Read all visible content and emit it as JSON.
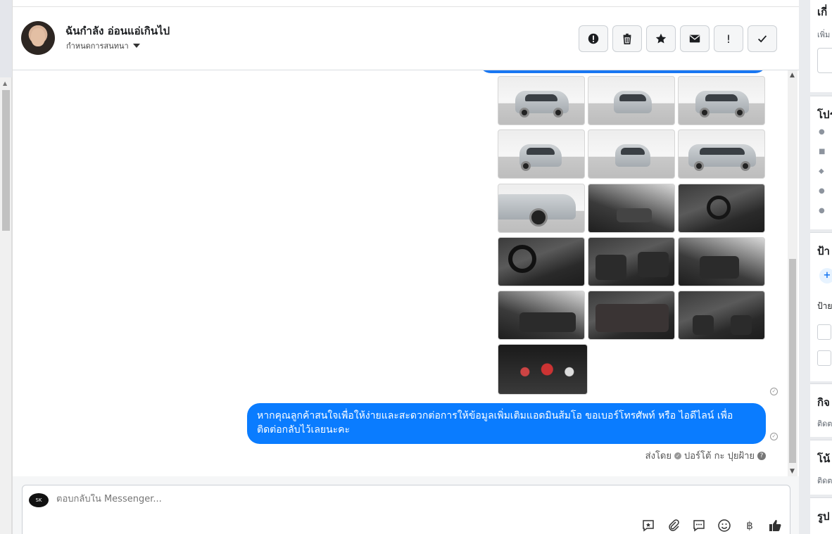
{
  "conversation": {
    "contact_name": "ฉันกำลัง อ่อนแอ่เกินไป",
    "assign_label": "กำหนดการสนทนา"
  },
  "header_actions": [
    {
      "name": "spam-icon",
      "label": ""
    },
    {
      "name": "trash-icon",
      "label": ""
    },
    {
      "name": "star-icon",
      "label": ""
    },
    {
      "name": "envelope-icon",
      "label": ""
    },
    {
      "name": "exclamation-icon",
      "label": "!"
    },
    {
      "name": "checkmark-icon",
      "label": ""
    }
  ],
  "messages": {
    "latest_text": "หากคุณลูกค้าสนใจเพื่อให้ง่ายและสะดวกต่อการให้ข้อมูลเพิ่มเติมแอดมินส้มโอ ขอเบอร์โทรศัพท์ หรือ ไอดีไลน์ เพื่อติดต่อกลับไว้เลยนะคะ",
    "sent_by_label": "ส่งโดย",
    "sender_name": "ปอร์โต้ กะ ปุยฝ้าย",
    "photo_count": 16
  },
  "composer": {
    "placeholder": "ตอบกลับใน Messenger...",
    "currency_symbol": "฿"
  },
  "side_panel": {
    "sections": [
      {
        "title": "เกี่",
        "sub": "เพิ่ม"
      },
      {
        "title": "โปร",
        "sub": ""
      },
      {
        "title": "ป้า",
        "sub": "ป้าย"
      },
      {
        "title": "กิจ",
        "sub": "ติดต"
      },
      {
        "title": "โน้",
        "sub": "ติดต"
      },
      {
        "title": "รูป",
        "sub": ""
      }
    ]
  }
}
